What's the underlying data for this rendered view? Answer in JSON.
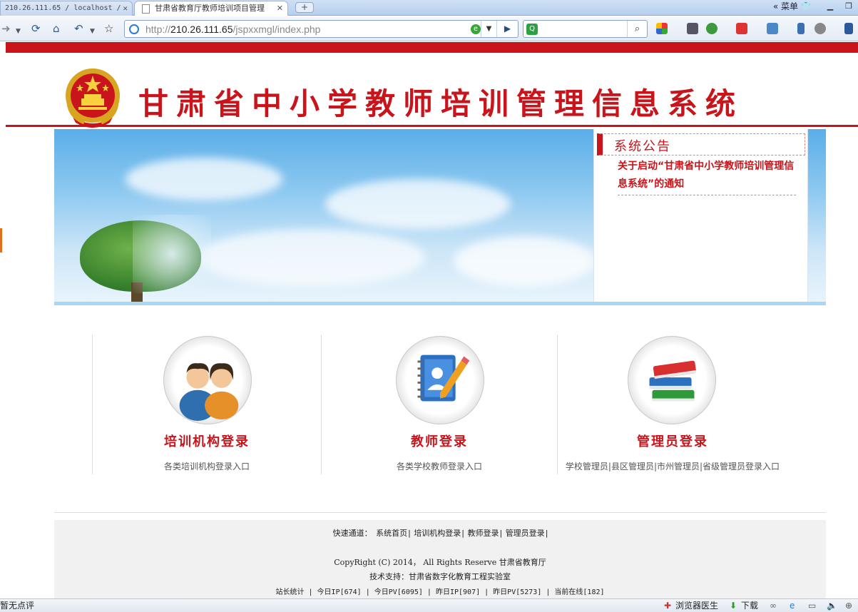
{
  "browser": {
    "tabs": [
      {
        "label": "210.26.111.65 / localhost /",
        "active": false
      },
      {
        "label": "甘肃省教育厅教师培训项目管理",
        "active": true
      }
    ],
    "tab_close": "✕",
    "new_tab": "+",
    "menu_label": "菜单",
    "menu_chevrons": "«",
    "url_prefix": "http://",
    "url_host": "210.26.111.65",
    "url_path": "/jspxxmgl/index.php",
    "search_value": ""
  },
  "header": {
    "site_title": "甘肃省中小学教师培训管理信息系统"
  },
  "notice": {
    "title": "系统公告",
    "items": [
      "关于启动“甘肃省中小学教师培训管理信息系统”的通知"
    ]
  },
  "entries": [
    {
      "label": "培训机构登录",
      "desc": "各类培训机构登录入口",
      "icon": "users-icon"
    },
    {
      "label": "教师登录",
      "desc": "各类学校教师登录入口",
      "icon": "notebook-pen-icon"
    },
    {
      "label": "管理员登录",
      "desc": "学校管理员|县区管理员|市州管理员|省级管理员登录入口",
      "icon": "books-icon"
    }
  ],
  "footer": {
    "quick_label": "快速通道：",
    "quick_links": [
      "系统首页",
      "培训机构登录",
      "教师登录",
      "管理员登录"
    ],
    "copyright": "CopyRight (C) 2014， All Rights Reserve  甘肃省教育厅",
    "support": "技术支持：甘肃省数字化教育工程实验室",
    "stats": "站长统计 | 今日IP[674] | 今日PV[6095] | 昨日IP[907] | 昨日PV[5273] | 当前在线[182]"
  },
  "statusbar": {
    "left_text": "暂无点评",
    "doctor": "浏览器医生",
    "download": "下载"
  },
  "colors": {
    "brand_red": "#c8141a",
    "banner_sky": "#8cc8f0"
  }
}
